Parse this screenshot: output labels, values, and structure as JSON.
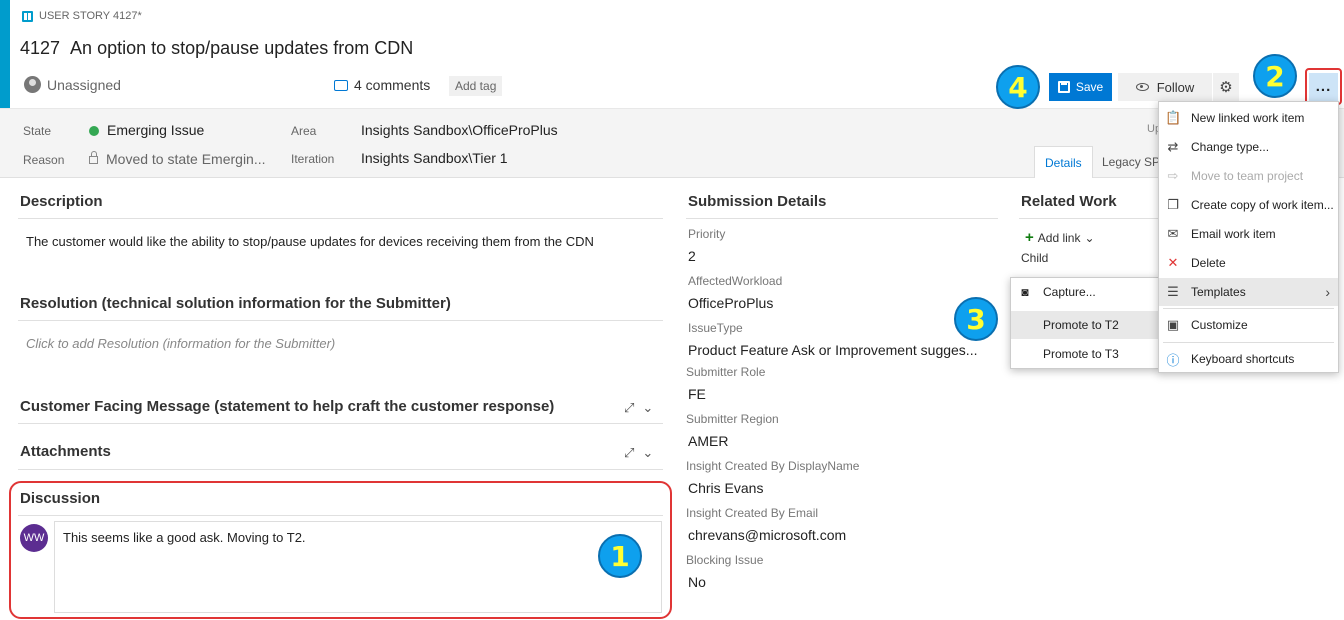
{
  "header": {
    "type_label": "USER STORY 4127*",
    "id": "4127",
    "title": "An option to stop/pause updates from CDN",
    "assignee": "Unassigned",
    "comments": "4 comments",
    "add_tag": "Add tag"
  },
  "toolbar": {
    "save_label": "Save",
    "follow_label": "Follow",
    "more_label": "..."
  },
  "fields": {
    "state_label": "State",
    "state_value": "Emerging Issue",
    "reason_label": "Reason",
    "reason_value": "Moved to state Emergin...",
    "area_label": "Area",
    "area_value": "Insights Sandbox\\OfficeProPlus",
    "iteration_label": "Iteration",
    "iteration_value": "Insights Sandbox\\Tier 1",
    "up_text": "Up"
  },
  "tabs": {
    "details": "Details",
    "legacy": "Legacy SPO"
  },
  "sections": {
    "description_title": "Description",
    "description_text": "The customer would like the ability to stop/pause updates for devices receiving them from the CDN",
    "resolution_title": "Resolution (technical solution information for the Submitter)",
    "resolution_placeholder": "Click to add Resolution (information for the Submitter)",
    "customer_title": "Customer Facing Message (statement to help craft the customer response)",
    "attachments_title": "Attachments",
    "discussion_title": "Discussion",
    "discussion_avatar": "WW",
    "discussion_text": "This seems like a good ask. Moving to T2."
  },
  "submission": {
    "title": "Submission Details",
    "fields": [
      {
        "label": "Priority",
        "value": "2"
      },
      {
        "label": "AffectedWorkload",
        "value": "OfficeProPlus"
      },
      {
        "label": "IssueType",
        "value": "Product Feature Ask or Improvement sugges..."
      },
      {
        "label": "Submitter Role",
        "value": "FE"
      },
      {
        "label": "Submitter Region",
        "value": "AMER"
      },
      {
        "label": "Insight Created By DisplayName",
        "value": "Chris Evans"
      },
      {
        "label": "Insight Created By Email",
        "value": "chrevans@microsoft.com"
      },
      {
        "label": "Blocking Issue",
        "value": "No"
      }
    ]
  },
  "related": {
    "title": "Related Work",
    "add_link": "Add link",
    "child_label": "Child"
  },
  "menu": {
    "items": [
      {
        "label": "New linked work item",
        "icon": "new-linked-icon"
      },
      {
        "label": "Change type...",
        "icon": "change-type-icon"
      },
      {
        "label": "Move to team project",
        "icon": "move-icon"
      },
      {
        "label": "Create copy of work item...",
        "icon": "copy-icon"
      },
      {
        "label": "Email work item",
        "icon": "email-icon"
      },
      {
        "label": "Delete",
        "icon": "delete-icon"
      },
      {
        "label": "Templates",
        "icon": "templates-icon"
      },
      {
        "label": "Customize",
        "icon": "customize-icon"
      },
      {
        "label": "Keyboard shortcuts",
        "icon": "info-icon"
      }
    ]
  },
  "submenu": {
    "items": [
      {
        "label": "Capture...",
        "icon": "camera-icon"
      },
      {
        "label": "Promote to T2"
      },
      {
        "label": "Promote to T3"
      }
    ]
  },
  "badges": {
    "one": "1",
    "two": "2",
    "three": "3",
    "four": "4"
  },
  "colors": {
    "accent": "#009ccc",
    "primary": "#0078d4",
    "highlight_border": "#e03535",
    "badge_fill": "#0ea0ee",
    "badge_text": "#ffff33",
    "state_dot": "#34a853"
  }
}
